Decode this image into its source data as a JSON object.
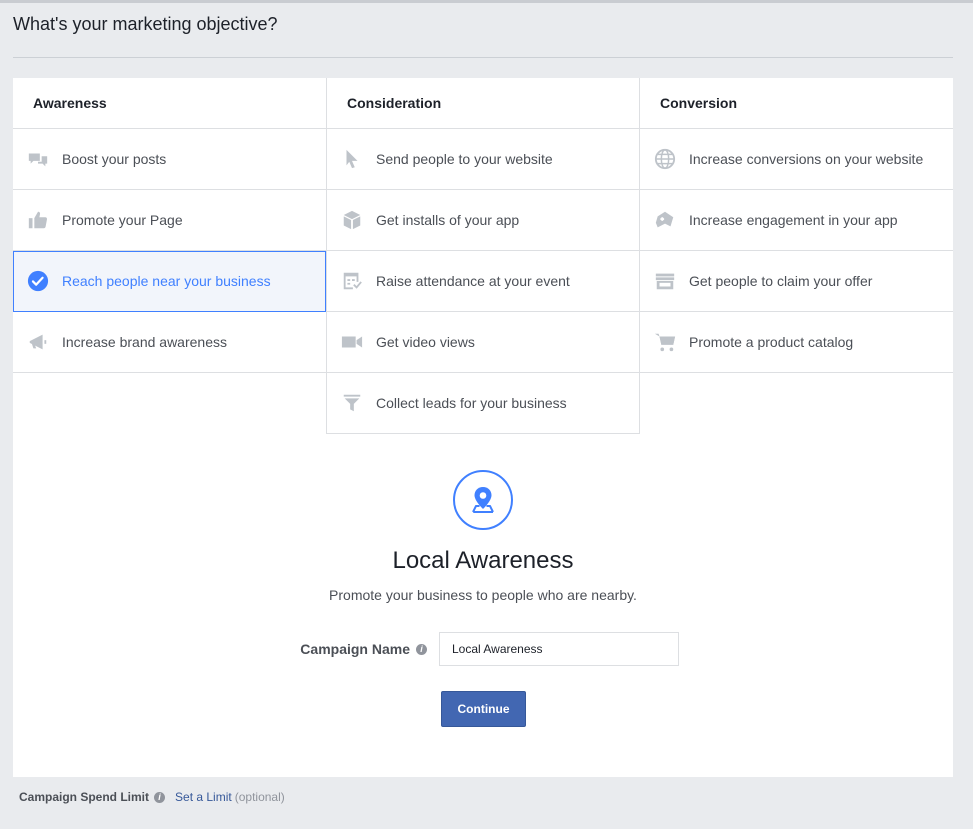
{
  "page": {
    "title": "What's your marketing objective?"
  },
  "columns": [
    {
      "header": "Awareness",
      "items": [
        {
          "label": "Boost your posts",
          "icon": "speech-bubbles-icon"
        },
        {
          "label": "Promote your Page",
          "icon": "thumbs-up-icon"
        },
        {
          "label": "Reach people near your business",
          "icon": "check-circle-icon",
          "selected": true
        },
        {
          "label": "Increase brand awareness",
          "icon": "megaphone-icon"
        }
      ]
    },
    {
      "header": "Consideration",
      "items": [
        {
          "label": "Send people to your website",
          "icon": "cursor-icon"
        },
        {
          "label": "Get installs of your app",
          "icon": "box-icon"
        },
        {
          "label": "Raise attendance at your event",
          "icon": "calendar-icon"
        },
        {
          "label": "Get video views",
          "icon": "video-camera-icon"
        },
        {
          "label": "Collect leads for your business",
          "icon": "funnel-icon"
        }
      ]
    },
    {
      "header": "Conversion",
      "items": [
        {
          "label": "Increase conversions on your website",
          "icon": "globe-icon"
        },
        {
          "label": "Increase engagement in your app",
          "icon": "game-controller-icon"
        },
        {
          "label": "Get people to claim your offer",
          "icon": "storefront-icon"
        },
        {
          "label": "Promote a product catalog",
          "icon": "shopping-cart-icon"
        }
      ]
    }
  ],
  "detail": {
    "icon": "map-pin-icon",
    "title": "Local Awareness",
    "description": "Promote your business to people who are nearby."
  },
  "campaign": {
    "name_label": "Campaign Name",
    "name_value": "Local Awareness",
    "continue_label": "Continue"
  },
  "footer": {
    "spend_limit_label": "Campaign Spend Limit",
    "set_limit_link": "Set a Limit",
    "optional_text": "(optional)"
  },
  "colors": {
    "accent": "#4080ff",
    "button": "#4267b2",
    "icon_gray": "#bec3c9"
  }
}
